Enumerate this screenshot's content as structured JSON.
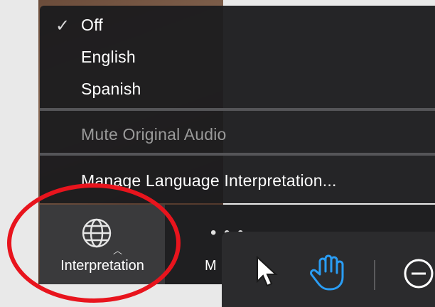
{
  "menu": {
    "items": [
      {
        "label": "Off",
        "checked": true
      },
      {
        "label": "English",
        "checked": false
      },
      {
        "label": "Spanish",
        "checked": false
      }
    ],
    "mute_label": "Mute Original Audio",
    "manage_label": "Manage Language Interpretation..."
  },
  "toolbar": {
    "interpretation_label": "Interpretation",
    "more_dots": "• • •",
    "more_label_partial": "M"
  },
  "annotation_toolbar": {
    "tools": [
      "arrow-pointer-icon",
      "hand-icon",
      "minus-circle-icon"
    ],
    "accent": "#2a9df4"
  },
  "annotation_circle_color": "#e8141d"
}
